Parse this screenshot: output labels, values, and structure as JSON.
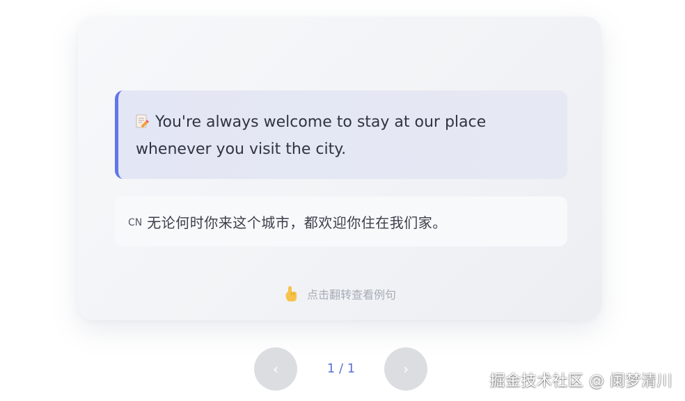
{
  "card": {
    "english_sentence": "You're always welcome to stay at our place whenever you visit the city.",
    "english_icon": "memo-pencil-icon",
    "chinese_tag": "CN",
    "chinese_sentence": "无论何时你来这个城市，都欢迎你住在我们家。",
    "hint_icon": "pointing-hand-icon",
    "hint_text": "点击翻转查看例句"
  },
  "pagination": {
    "prev_label": "‹",
    "next_label": "›",
    "counter": "1 / 1"
  },
  "watermark": "掘金技术社区 @ 阑梦清川",
  "colors": {
    "accent": "#6475e8",
    "counter": "#5b6fd6",
    "nav_button": "#dcdde0"
  }
}
